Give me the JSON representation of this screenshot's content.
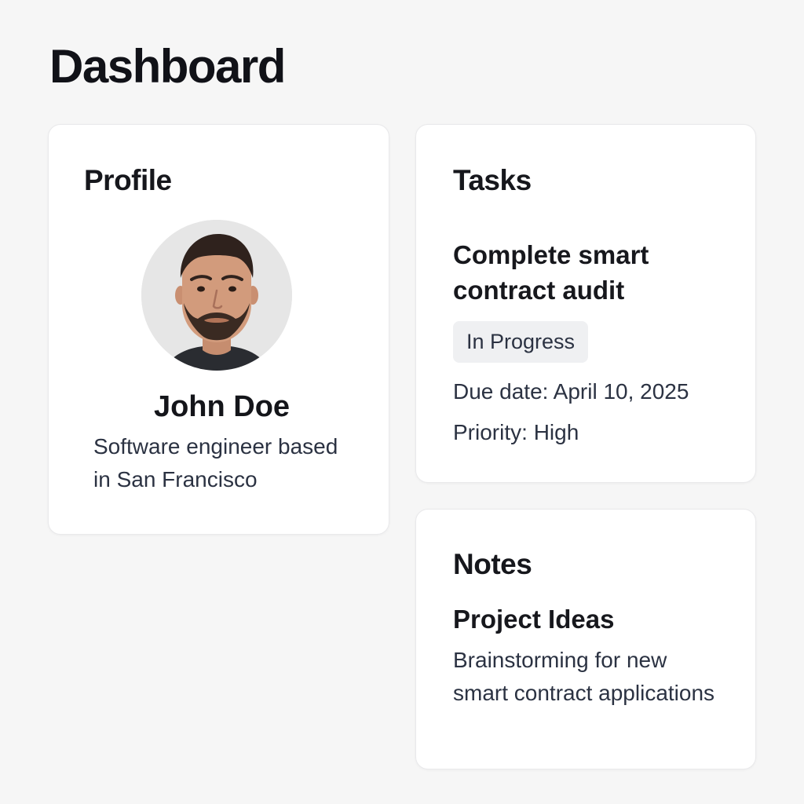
{
  "header": {
    "title": "Dashboard"
  },
  "profile": {
    "heading": "Profile",
    "avatar_icon": "user-photo",
    "name": "John Doe",
    "bio": "Software engineer based in San Francisco"
  },
  "tasks": {
    "heading": "Tasks",
    "items": [
      {
        "title": "Complete smart contract audit",
        "status": "In Progress",
        "due_label": "Due date:",
        "due_value": "April 10, 2025",
        "priority_label": "Priority:",
        "priority_value": "High"
      }
    ]
  },
  "notes": {
    "heading": "Notes",
    "items": [
      {
        "title": "Project Ideas",
        "body": "Brainstorming for new smart contract applications"
      }
    ]
  },
  "colors": {
    "background": "#f6f6f6",
    "card": "#ffffff",
    "text_primary": "#14151a",
    "text_secondary": "#2b3242",
    "badge_bg": "#eff0f2"
  }
}
